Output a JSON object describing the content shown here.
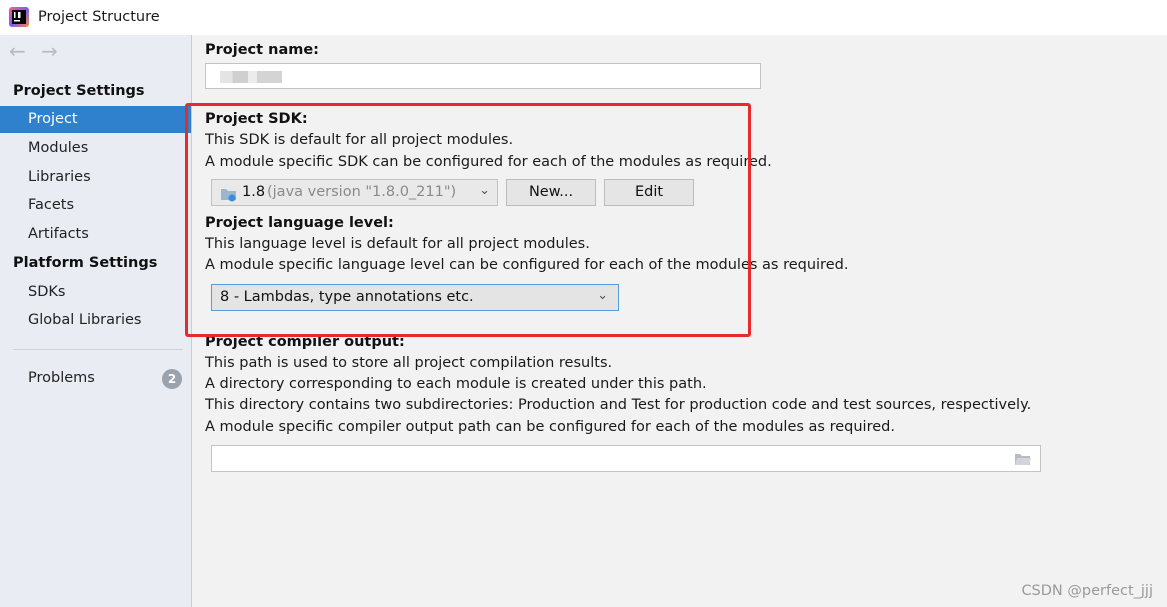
{
  "window": {
    "title": "Project Structure",
    "app_icon": "intellij-idea-icon"
  },
  "sidebar": {
    "back_icon": "←",
    "forward_icon": "→",
    "project_settings_header": "Project Settings",
    "project_settings_items": [
      {
        "label": "Project",
        "selected": true
      },
      {
        "label": "Modules"
      },
      {
        "label": "Libraries"
      },
      {
        "label": "Facets"
      },
      {
        "label": "Artifacts"
      }
    ],
    "platform_settings_header": "Platform Settings",
    "platform_settings_items": [
      {
        "label": "SDKs"
      },
      {
        "label": "Global Libraries"
      }
    ],
    "problems": {
      "label": "Problems",
      "count": "2"
    }
  },
  "main": {
    "project_name_label": "Project name:",
    "project_name_value": "",
    "sdk": {
      "title": "Project SDK:",
      "desc1": "This SDK is default for all project modules.",
      "desc2": "A module specific SDK can be configured for each of the modules as required.",
      "selected_version": "1.8",
      "selected_detail": "(java version \"1.8.0_211\")",
      "new_button": "New...",
      "edit_button": "Edit"
    },
    "language_level": {
      "title": "Project language level:",
      "desc1": "This language level is default for all project modules.",
      "desc2": "A module specific language level can be configured for each of the modules as required.",
      "selected": "8 - Lambdas, type annotations etc."
    },
    "compiler_output": {
      "title": "Project compiler output:",
      "desc1": "This path is used to store all project compilation results.",
      "desc2": "A directory corresponding to each module is created under this path.",
      "desc3": "This directory contains two subdirectories: Production and Test for production code and test sources, respectively.",
      "desc4": "A module specific compiler output path can be configured for each of the modules as required.",
      "path_value": ""
    }
  },
  "watermark": "CSDN @perfect_jjj",
  "colors": {
    "selection": "#2f80cd",
    "highlight_box": "#e52b2b"
  }
}
